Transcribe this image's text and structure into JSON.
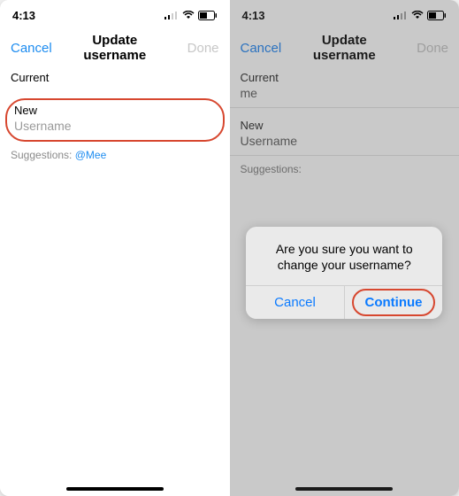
{
  "left": {
    "status": {
      "time": "4:13"
    },
    "nav": {
      "cancel": "Cancel",
      "title": "Update username",
      "done": "Done"
    },
    "current_label": "Current",
    "current_value": "",
    "new_label": "New",
    "new_placeholder": "Username",
    "suggestions_prefix": "Suggestions:",
    "suggestion_value": "@Mee"
  },
  "right": {
    "status": {
      "time": "4:13"
    },
    "nav": {
      "cancel": "Cancel",
      "title": "Update username",
      "done": "Done"
    },
    "current_label": "Current",
    "current_value": "me",
    "new_label": "New",
    "new_placeholder": "Username",
    "suggestions_prefix": "Suggestions:"
  },
  "dialog": {
    "message": "Are you sure you want to change your username?",
    "cancel": "Cancel",
    "continue": "Continue"
  }
}
